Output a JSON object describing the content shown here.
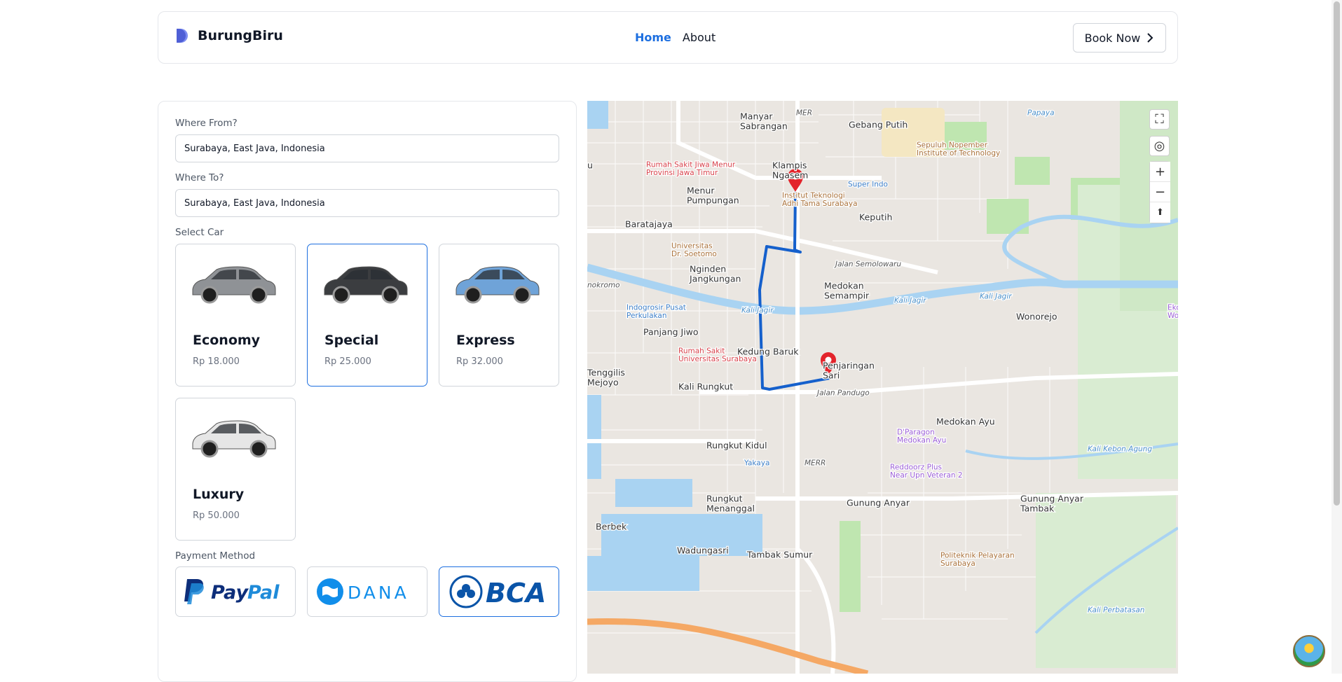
{
  "navbar": {
    "brand": "BurungBiru",
    "links": [
      {
        "label": "Home",
        "active": true
      },
      {
        "label": "About",
        "active": false
      }
    ],
    "cta_label": "Book Now"
  },
  "form": {
    "from_label": "Where From?",
    "from_value": "Surabaya, East Java, Indonesia",
    "to_label": "Where To?",
    "to_value": "Surabaya, East Java, Indonesia",
    "select_car_label": "Select Car",
    "cars": [
      {
        "name": "Economy",
        "price": "Rp 18.000",
        "color": "#8f9296",
        "selected": false
      },
      {
        "name": "Special",
        "price": "Rp 25.000",
        "color": "#3b3d40",
        "selected": true
      },
      {
        "name": "Express",
        "price": "Rp 32.000",
        "color": "#6fa3d8",
        "selected": false
      },
      {
        "name": "Luxury",
        "price": "Rp 50.000",
        "color": "#e6e6e6",
        "selected": false
      }
    ],
    "payment_label": "Payment Method",
    "payments": [
      {
        "name": "PayPal",
        "selected": false
      },
      {
        "name": "DANA",
        "selected": false
      },
      {
        "name": "BCA",
        "selected": true
      }
    ]
  },
  "map": {
    "places": [
      {
        "text": "Manyar\nSabrangan",
        "kind": "area"
      },
      {
        "text": "Gebang Putih",
        "kind": "area"
      },
      {
        "text": "Sepuluh Nopember\nInstitute of Technology",
        "kind": "edu"
      },
      {
        "text": "Papaya",
        "kind": "water"
      },
      {
        "text": "Rumah Sakit Jiwa Menur\nProvinsi Jawa Timur",
        "kind": "hospital"
      },
      {
        "text": "Klampis\nNgasem",
        "kind": "area"
      },
      {
        "text": "Super Indo",
        "kind": "shop"
      },
      {
        "text": "Menur\nPumpungan",
        "kind": "area"
      },
      {
        "text": "Institut Teknologi\nAdhi Tama Surabaya",
        "kind": "edu"
      },
      {
        "text": "Keputih",
        "kind": "area"
      },
      {
        "text": "Baratajaya",
        "kind": "area"
      },
      {
        "text": "Universitas\nDr. Soetomo",
        "kind": "edu"
      },
      {
        "text": "Nginden\nJangkungan",
        "kind": "area"
      },
      {
        "text": "Jalan Semolowaru",
        "kind": "road"
      },
      {
        "text": "Kali Jagir",
        "kind": "water"
      },
      {
        "text": "nokromo",
        "kind": "road"
      },
      {
        "text": "Medokan\nSemampir",
        "kind": "area"
      },
      {
        "text": "Indogrosir Pusat\nPerkulakan",
        "kind": "shop"
      },
      {
        "text": "Kali Jagir",
        "kind": "water"
      },
      {
        "text": "Kali Jagir",
        "kind": "water"
      },
      {
        "text": "Wonorejo",
        "kind": "area"
      },
      {
        "text": "Ekowisata Mangrove\nWonorejo",
        "kind": "poi"
      },
      {
        "text": "Panjang Jiwo",
        "kind": "area"
      },
      {
        "text": "Rumah Sakit\nUniversitas Surabaya",
        "kind": "hospital"
      },
      {
        "text": "Kedung Baruk",
        "kind": "area"
      },
      {
        "text": "Penjaringan\nSari",
        "kind": "area"
      },
      {
        "text": "Tenggilis\nMejoyo",
        "kind": "area"
      },
      {
        "text": "Kali Rungkut",
        "kind": "area"
      },
      {
        "text": "Jalan Pandugo",
        "kind": "road"
      },
      {
        "text": "Medokan Ayu",
        "kind": "area"
      },
      {
        "text": "D'Paragon\nMedokan Ayu",
        "kind": "poi"
      },
      {
        "text": "Rungkut Kidul",
        "kind": "area"
      },
      {
        "text": "Yakaya",
        "kind": "shop"
      },
      {
        "text": "Reddoorz Plus\nNear Upn Veteran 2",
        "kind": "poi"
      },
      {
        "text": "Kali Kebon Agung",
        "kind": "water"
      },
      {
        "text": "MERR",
        "kind": "road"
      },
      {
        "text": "Rungkut\nMenanggal",
        "kind": "area"
      },
      {
        "text": "Gunung Anyar",
        "kind": "area"
      },
      {
        "text": "Gunung Anyar\nTambak",
        "kind": "area"
      },
      {
        "text": "Berbek",
        "kind": "area"
      },
      {
        "text": "Wadungasri",
        "kind": "area"
      },
      {
        "text": "Tambak Sumur",
        "kind": "area"
      },
      {
        "text": "Politeknik Pelayaran\nSurabaya",
        "kind": "edu"
      },
      {
        "text": "Kali Perbatasan",
        "kind": "water"
      },
      {
        "text": "u",
        "kind": "area"
      },
      {
        "text": "MER",
        "kind": "road"
      }
    ],
    "controls": [
      {
        "name": "fullscreen",
        "symbol": "⛶"
      },
      {
        "name": "locate",
        "symbol": "◎"
      },
      {
        "name": "zoom-in",
        "symbol": "+"
      },
      {
        "name": "zoom-out",
        "symbol": "−"
      },
      {
        "name": "compass",
        "symbol": "⬆"
      }
    ],
    "colors": {
      "route": "#1560cc",
      "marker": "#e3242b",
      "water": "#a9d3f2",
      "park": "#bfe6b0",
      "road": "#ffffff",
      "toll": "#f5a864",
      "area_text": "#333333",
      "hospital_text": "#d8434c",
      "edu_text": "#a9713a",
      "poi_text": "#9b5fd6",
      "shop_text": "#3d7ec6",
      "water_text": "#4a8fc9",
      "road_text": "#555555"
    }
  },
  "colors": {
    "accent": "#1d6fe0",
    "border": "#d1d5db",
    "muted_text": "#6b7280"
  }
}
